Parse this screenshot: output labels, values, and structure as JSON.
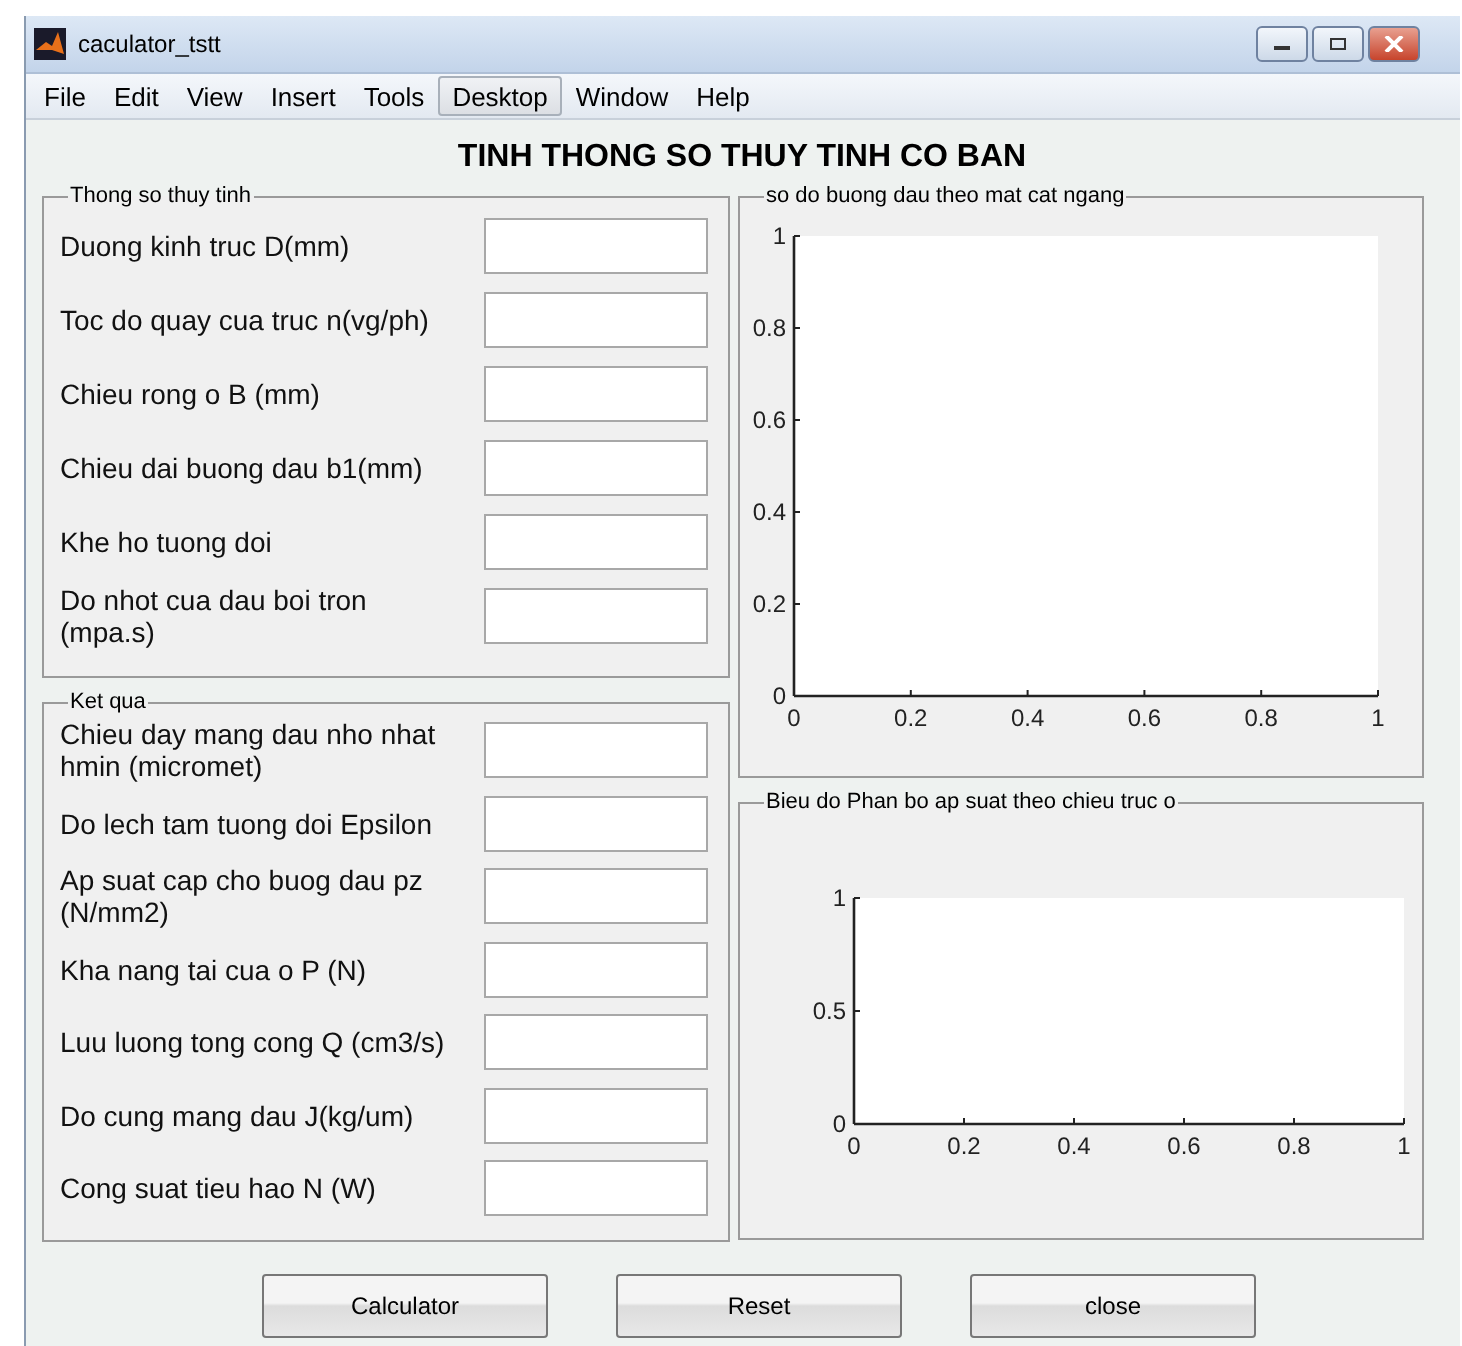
{
  "window": {
    "title": "caculator_tstt"
  },
  "menu": [
    {
      "label": "File",
      "highlighted": false
    },
    {
      "label": "Edit",
      "highlighted": false
    },
    {
      "label": "View",
      "highlighted": false
    },
    {
      "label": "Insert",
      "highlighted": false
    },
    {
      "label": "Tools",
      "highlighted": false
    },
    {
      "label": "Desktop",
      "highlighted": true
    },
    {
      "label": "Window",
      "highlighted": false
    },
    {
      "label": "Help",
      "highlighted": false
    }
  ],
  "heading": "TINH THONG SO THUY TINH CO BAN",
  "input_group": {
    "title": "Thong so thuy tinh",
    "fields": [
      {
        "label": "Duong kinh truc D(mm)"
      },
      {
        "label": "Toc do quay cua truc n(vg/ph)"
      },
      {
        "label": "Chieu rong o  B (mm)"
      },
      {
        "label": "Chieu dai buong dau b1(mm)"
      },
      {
        "label": "Khe ho tuong doi"
      },
      {
        "label": "Do nhot cua dau boi tron (mpa.s)"
      }
    ]
  },
  "result_group": {
    "title": "Ket qua",
    "fields": [
      {
        "label": "Chieu day mang dau nho nhat hmin (micromet)"
      },
      {
        "label": "Do lech tam tuong doi Epsilon"
      },
      {
        "label": "Ap suat cap cho buog dau pz (N/mm2)"
      },
      {
        "label": "Kha nang tai cua o P (N)"
      },
      {
        "label": "Luu luong tong cong Q (cm3/s)"
      },
      {
        "label": "Do cung mang dau J(kg/um)"
      },
      {
        "label": "Cong suat tieu hao N (W)"
      }
    ]
  },
  "charts": [
    {
      "title": "so do buong dau theo mat cat ngang",
      "chart_data": {
        "type": "line",
        "xlim": [
          0,
          1
        ],
        "ylim": [
          0,
          1
        ],
        "xticks": [
          0,
          0.2,
          0.4,
          0.6,
          0.8,
          1
        ],
        "yticks": [
          0,
          0.2,
          0.4,
          0.6,
          0.8,
          1
        ]
      }
    },
    {
      "title": "Bieu do Phan bo ap suat theo chieu truc o",
      "chart_data": {
        "type": "line",
        "xlim": [
          0,
          1
        ],
        "ylim": [
          0,
          1
        ],
        "xticks": [
          0,
          0.2,
          0.4,
          0.6,
          0.8,
          1
        ],
        "yticks": [
          0,
          0.5,
          1
        ]
      }
    }
  ],
  "buttons": [
    {
      "label": "Calculator"
    },
    {
      "label": "Reset"
    },
    {
      "label": "close"
    }
  ]
}
